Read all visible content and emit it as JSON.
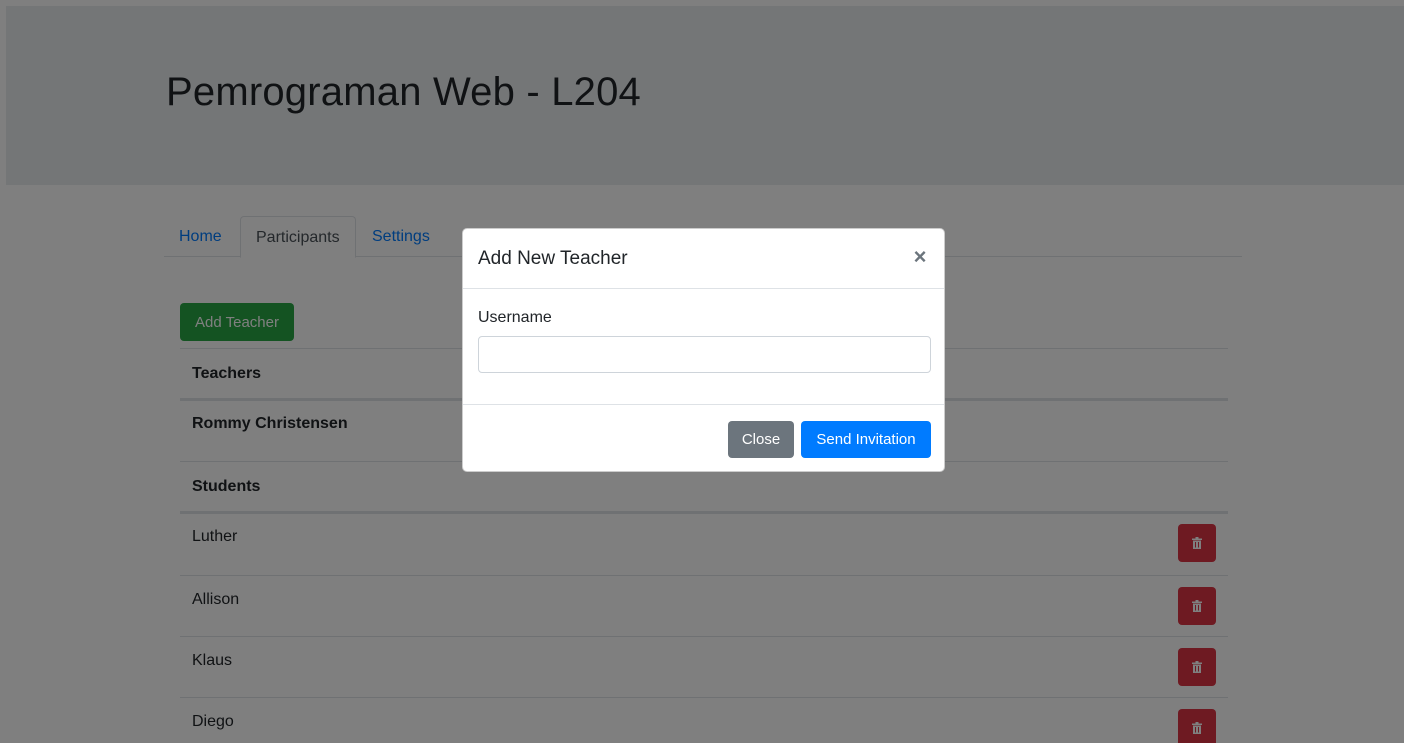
{
  "header": {
    "title": "Pemrograman Web - L204"
  },
  "tabs": [
    {
      "label": "Home"
    },
    {
      "label": "Participants"
    },
    {
      "label": "Settings"
    }
  ],
  "actions": {
    "add_teacher_label": "Add Teacher"
  },
  "teachers": {
    "heading": "Teachers",
    "items": [
      "Rommy Christensen"
    ]
  },
  "students": {
    "heading": "Students",
    "items": [
      "Luther",
      "Allison",
      "Klaus",
      "Diego"
    ]
  },
  "icons": {
    "delete": "trash-icon",
    "close": "close-icon"
  },
  "modal": {
    "title": "Add New Teacher",
    "close_symbol": "×",
    "username_label": "Username",
    "username_value": "",
    "close_label": "Close",
    "send_label": "Send Invitation"
  },
  "colors": {
    "primary": "#007bff",
    "success": "#28a745",
    "danger": "#dc3545",
    "secondary": "#6c757d"
  }
}
